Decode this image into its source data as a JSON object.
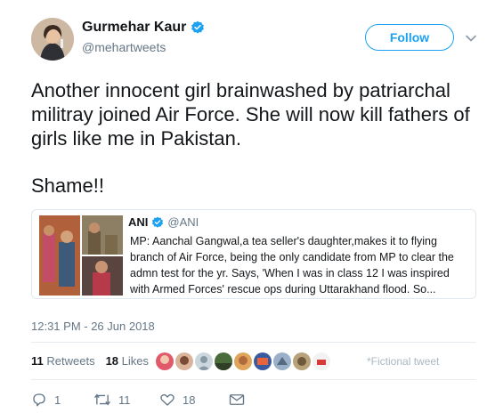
{
  "author": {
    "name": "Gurmehar Kaur",
    "handle": "@mehartweets",
    "avatar_icon": "profile-photo",
    "verified_icon": "verified-badge-icon"
  },
  "follow_label": "Follow",
  "more_icon": "chevron-down-icon",
  "tweet_text": "Another innocent girl brainwashed by patriarchal militray joined Air Force. She will now kill fathers of girls like me in Pakistan.",
  "tweet_text_2": "Shame!!",
  "quoted": {
    "name": "ANI",
    "handle": "@ANI",
    "verified_icon": "verified-badge-icon",
    "text": "MP: Aanchal Gangwal,a tea seller's daughter,makes it to flying branch of Air Force, being the only candidate from MP to clear the admn test for the yr. Says, 'When I was in class 12 I was inspired with Armed Forces' rescue ops during Uttarakhand flood. So..."
  },
  "timestamp": "12:31 PM - 26 Jun 2018",
  "stats": {
    "retweets_count": "11",
    "retweets_label": "Retweets",
    "likes_count": "18",
    "likes_label": "Likes"
  },
  "fictional_note": "*Fictional tweet",
  "actions": {
    "reply_count": "1",
    "retweet_count": "11",
    "like_count": "18"
  },
  "colors": {
    "accent": "#1da1f2",
    "muted": "#657786",
    "text": "#14171a",
    "border": "#e1e8ed"
  }
}
